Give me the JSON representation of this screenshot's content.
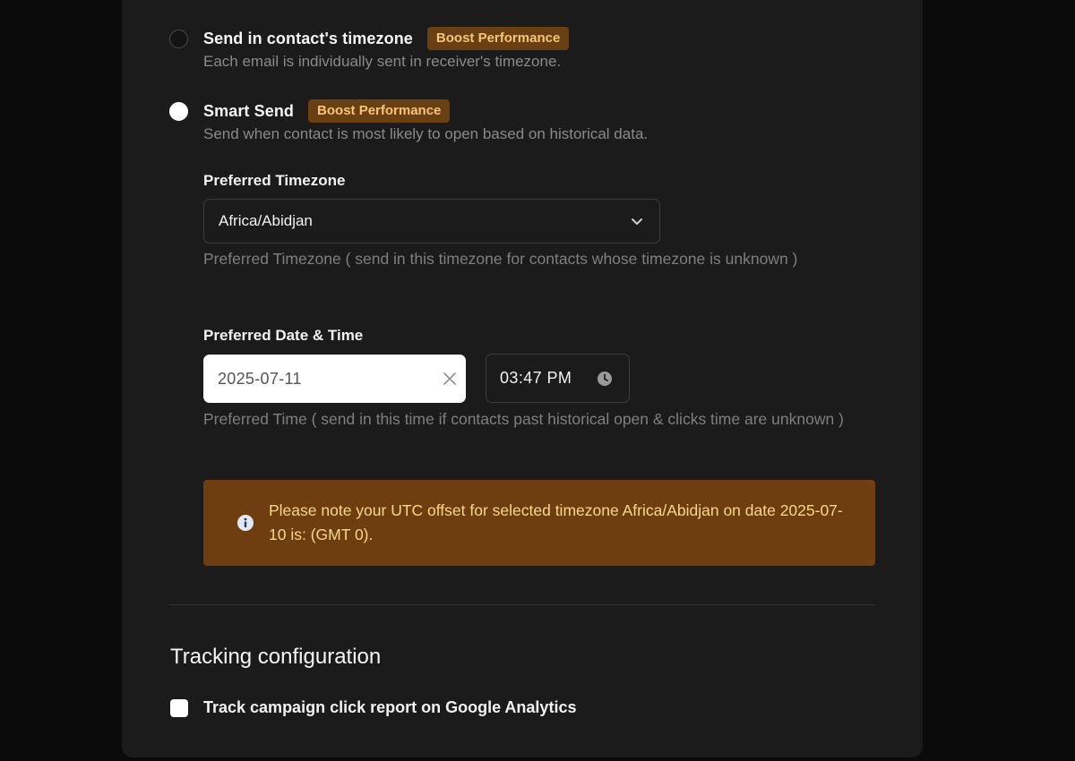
{
  "send_options": [
    {
      "title": "Send in contact's timezone",
      "badge": "Boost Performance",
      "description": "Each email is individually sent in receiver's timezone.",
      "selected": false
    },
    {
      "title": "Smart Send",
      "badge": "Boost Performance",
      "description": "Send when contact is most likely to open based on historical data.",
      "selected": true
    }
  ],
  "timezone": {
    "label": "Preferred Timezone",
    "value": "Africa/Abidjan",
    "help": "Preferred Timezone ( send in this timezone for contacts whose timezone is unknown )"
  },
  "datetime": {
    "label": "Preferred Date & Time",
    "date": "2025-07-11",
    "time": "03:47 PM",
    "help": "Preferred Time ( send in this time if contacts past historical open & clicks time are unknown )"
  },
  "notice": {
    "text": "Please note your UTC offset for selected timezone Africa/Abidjan on date 2025-07-10 is: (GMT 0)."
  },
  "tracking": {
    "title": "Tracking configuration",
    "checkbox_label": "Track campaign click report on Google Analytics",
    "checked": false
  },
  "colors": {
    "panel": "#1b1b1b",
    "badge_bg": "#6a3f12",
    "badge_text": "#f6c47a",
    "notice_bg": "#6e3d10",
    "notice_text": "#f8d88a"
  }
}
